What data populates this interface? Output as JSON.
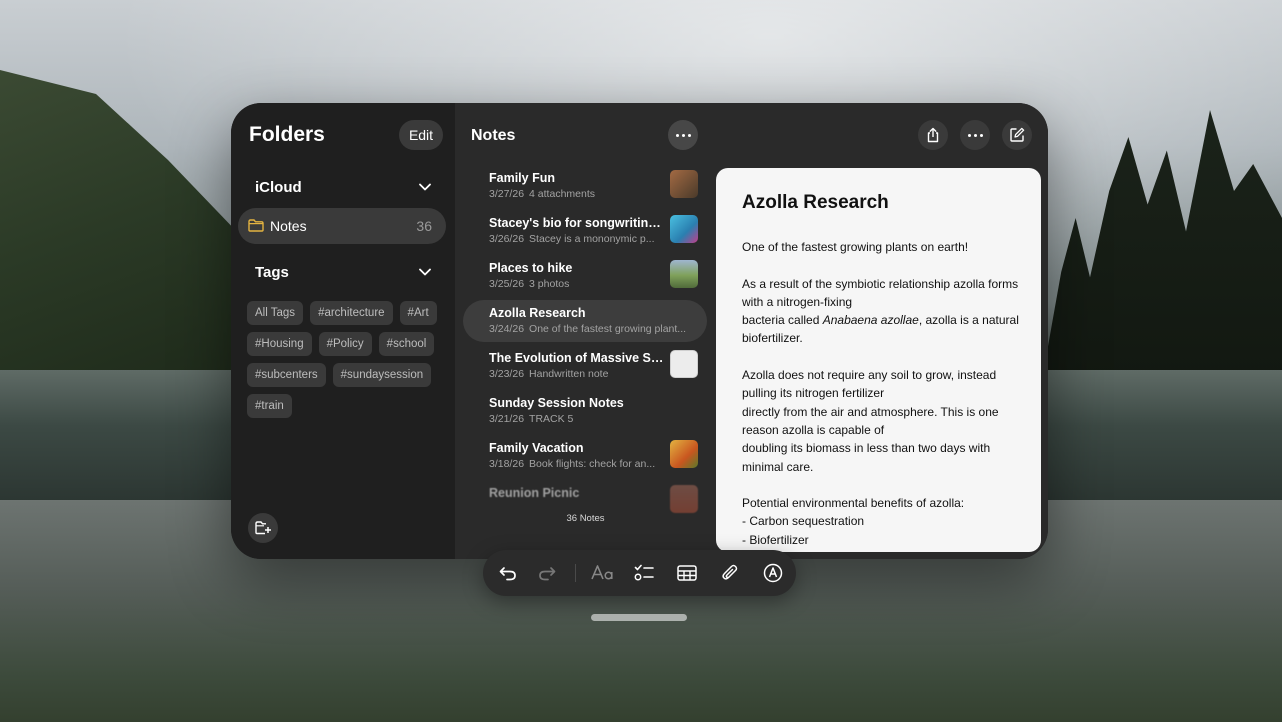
{
  "sidebar": {
    "title": "Folders",
    "edit_label": "Edit",
    "account": "iCloud",
    "folder": {
      "label": "Notes",
      "count": "36"
    },
    "tags_header": "Tags",
    "tags": [
      "All Tags",
      "#architecture",
      "#Art",
      "#Housing",
      "#Policy",
      "#school",
      "#subcenters",
      "#sundaysession",
      "#train"
    ]
  },
  "list": {
    "title": "Notes",
    "count_label": "36 Notes",
    "notes": [
      {
        "title": "Family Fun",
        "date": "3/27/26",
        "preview": "4 attachments",
        "thumb_color": "#7a5a3a"
      },
      {
        "title": "Stacey's bio for songwriting...",
        "date": "3/26/26",
        "preview": "Stacey is a mononymic p...",
        "thumb_color": "#3aa7c9"
      },
      {
        "title": "Places to hike",
        "date": "3/25/26",
        "preview": "3 photos",
        "thumb_color": "#7fa15a"
      },
      {
        "title": "Azolla Research",
        "date": "3/24/26",
        "preview": "One of the fastest growing plant...",
        "thumb_color": ""
      },
      {
        "title": "The Evolution of Massive St...",
        "date": "3/23/26",
        "preview": "Handwritten note",
        "thumb_color": "#e8e8e8"
      },
      {
        "title": "Sunday Session Notes",
        "date": "3/21/26",
        "preview": "TRACK 5",
        "thumb_color": ""
      },
      {
        "title": "Family Vacation",
        "date": "3/18/26",
        "preview": "Book flights: check for an...",
        "thumb_color": "#d99a2a"
      },
      {
        "title": "Reunion Picnic",
        "date": "",
        "preview": "",
        "thumb_color": "#b0503a"
      }
    ]
  },
  "detail": {
    "title": "Azolla Research",
    "paragraphs": [
      [
        "One of the fastest growing plants on earth!"
      ],
      [
        "As a result of the symbiotic relationship azolla forms with a nitrogen-fixing",
        "bacteria called ",
        "Anabaena azollae",
        ", azolla is a natural biofertilizer."
      ],
      [
        "Azolla does not require any soil to grow, instead pulling its nitrogen fertilizer",
        "directly from the air and atmosphere. This is one reason azolla is capable of",
        "doubling its biomass in less than two days with minimal care."
      ],
      [
        "Potential environmental benefits of azolla:",
        "- Carbon sequestration",
        "- Biofertilizer"
      ]
    ]
  },
  "colors": {
    "accent_folder": "#e3b341",
    "card_bg": "#f6f6f6",
    "window_bg": "#232323"
  }
}
